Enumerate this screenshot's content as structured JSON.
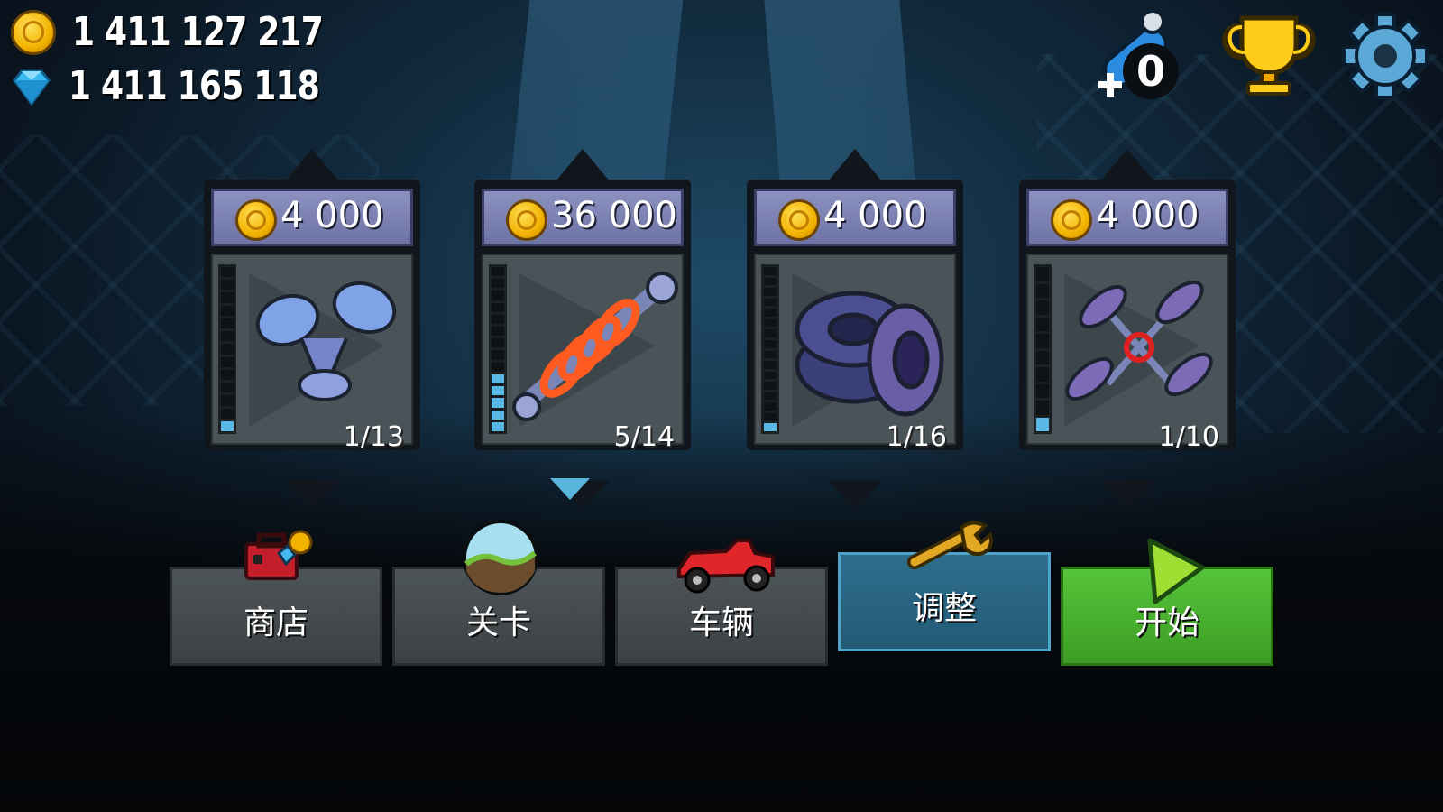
{
  "currency": {
    "coins": "1 411 127 217",
    "gems": "1 411 165 118"
  },
  "top_right": {
    "fuel_count": "0",
    "icons": [
      "fuel-boost-icon",
      "trophy-icon",
      "gear-icon"
    ]
  },
  "upgrades": [
    {
      "name": "engine",
      "price": "4 000",
      "level": "1/13",
      "level_value": 1,
      "level_max": 13,
      "icon": "engine-pistons-icon"
    },
    {
      "name": "suspension",
      "price": "36 000",
      "level": "5/14",
      "level_value": 5,
      "level_max": 14,
      "icon": "shock-absorber-icon",
      "selected": true
    },
    {
      "name": "tires",
      "price": "4 000",
      "level": "1/16",
      "level_value": 1,
      "level_max": 16,
      "icon": "tires-icon"
    },
    {
      "name": "4wd",
      "price": "4 000",
      "level": "1/10",
      "level_value": 1,
      "level_max": 10,
      "icon": "drivetrain-icon"
    }
  ],
  "nav": {
    "shop": "商店",
    "stages": "关卡",
    "vehicles": "车辆",
    "tuning": "调整",
    "start": "开始",
    "active": "tuning"
  },
  "colors": {
    "price_bar": "#7a80b3",
    "meter_on": "#5ab8e6",
    "tuning_active": "#2e6e8c",
    "start_green": "#4cb230",
    "coin_gold": "#f2b300"
  }
}
